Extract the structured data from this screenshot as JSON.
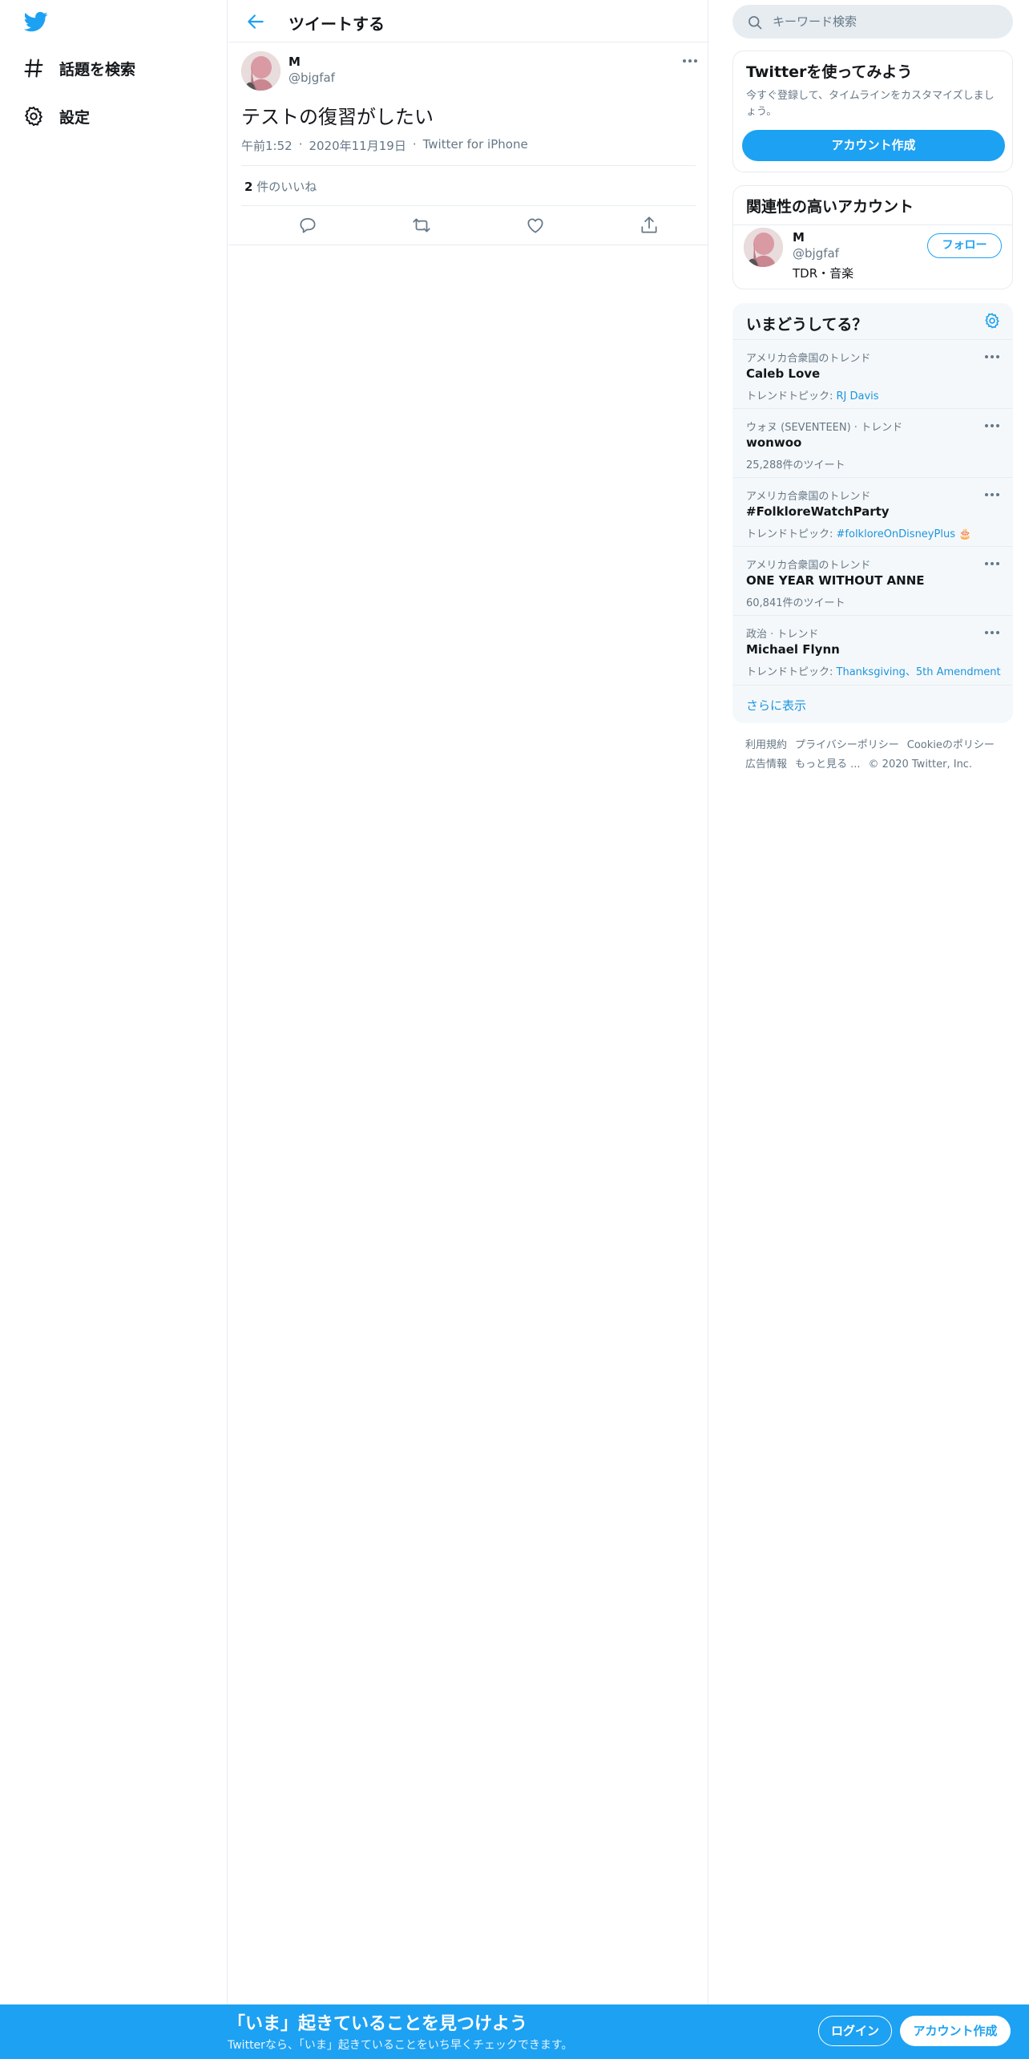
{
  "colors": {
    "accent": "#1da1f2",
    "link": "#1b95e0",
    "secondary_text": "#657786",
    "divider": "#e6ecf0"
  },
  "left_nav": {
    "logo_icon": "twitter-bird-icon",
    "items": [
      {
        "icon": "hashtag-icon",
        "label": "話題を検索"
      },
      {
        "icon": "gear-icon",
        "label": "設定"
      }
    ]
  },
  "main": {
    "header": {
      "back_icon": "arrow-left-icon",
      "title": "ツイートする"
    },
    "tweet": {
      "name": "M",
      "handle": "@bjgfaf",
      "text": "テストの復習がしたい",
      "time": "午前1:52",
      "date": "2020年11月19日",
      "source": "Twitter for iPhone",
      "dot": "·",
      "likes_count": "2",
      "likes_label": "件のいいね",
      "actions": [
        "reply-icon",
        "retweet-icon",
        "like-icon",
        "share-icon"
      ]
    }
  },
  "right": {
    "search": {
      "placeholder": "キーワード検索"
    },
    "signup": {
      "title": "Twitterを使ってみよう",
      "description": "今すぐ登録して、タイムラインをカスタマイズしましょう。",
      "button": "アカウント作成"
    },
    "related": {
      "title": "関連性の高いアカウント",
      "name": "M",
      "handle": "@bjgfaf",
      "bio": "TDR・音楽",
      "follow_button": "フォロー"
    },
    "trends": {
      "title": "いまどうしてる？",
      "items": [
        {
          "context": "アメリカ合衆国のトレンド",
          "name": "Caleb Love",
          "sub_prefix": "トレンドトピック: ",
          "sub_link": "RJ Davis"
        },
        {
          "context": "ウォヌ (SEVENTEEN) · トレンド",
          "name": "wonwoo",
          "sub_prefix": "25,288件のツイート",
          "sub_link": ""
        },
        {
          "context": "アメリカ合衆国のトレンド",
          "name": "#FolkloreWatchParty",
          "sub_prefix": "トレンドトピック: ",
          "sub_link": "#folkloreOnDisneyPlus 🎂"
        },
        {
          "context": "アメリカ合衆国のトレンド",
          "name": "ONE YEAR WITHOUT ANNE",
          "sub_prefix": "60,841件のツイート",
          "sub_link": ""
        },
        {
          "context": "政治 · トレンド",
          "name": "Michael Flynn",
          "sub_prefix": "トレンドトピック: ",
          "sub_link": "Thanksgiving、5th Amendment"
        }
      ],
      "show_more": "さらに表示"
    },
    "footer": {
      "links": [
        "利用規約",
        "プライバシーポリシー",
        "Cookieのポリシー",
        "広告情報",
        "もっと見る ..."
      ],
      "copyright": "© 2020 Twitter, Inc."
    }
  },
  "bottom_banner": {
    "title": "「いま」起きていることを見つけよう",
    "subtitle": "Twitterなら、「いま」起きていることをいち早くチェックできます。",
    "login_button": "ログイン",
    "signup_button": "アカウント作成"
  }
}
